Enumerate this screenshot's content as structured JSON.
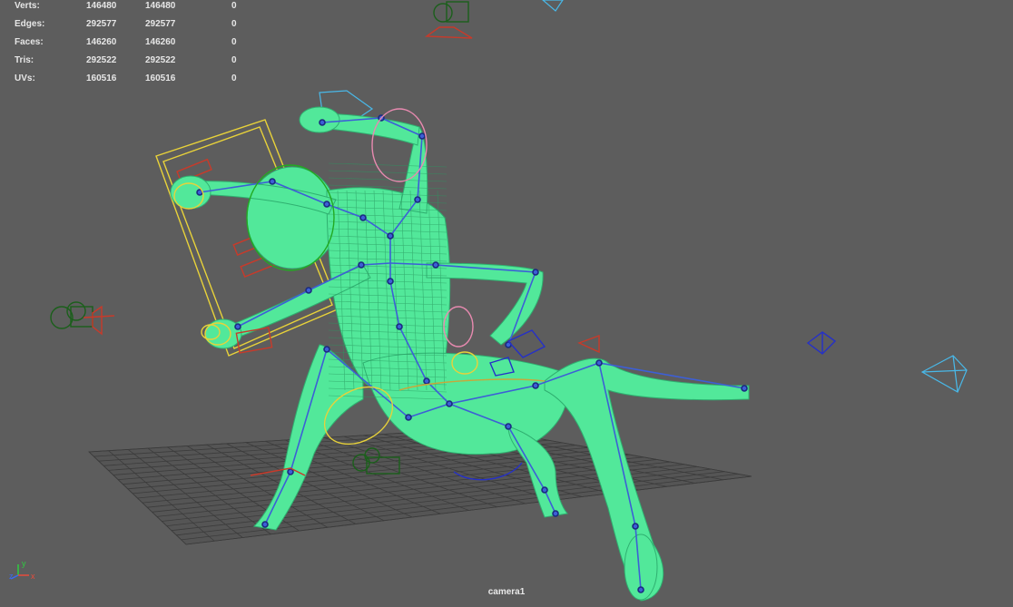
{
  "poly_count": {
    "rows": [
      {
        "label": "Verts:",
        "v1": "146480",
        "v2": "146480",
        "v3": "0"
      },
      {
        "label": "Edges:",
        "v1": "292577",
        "v2": "292577",
        "v3": "0"
      },
      {
        "label": "Faces:",
        "v1": "146260",
        "v2": "146260",
        "v3": "0"
      },
      {
        "label": "Tris:",
        "v1": "292522",
        "v2": "292522",
        "v3": "0"
      },
      {
        "label": "UVs:",
        "v1": "160516",
        "v2": "160516",
        "v3": "0"
      }
    ]
  },
  "viewport": {
    "camera_name": "camera1",
    "background_color": "#5d5d5d",
    "mesh_color": "#52e89a",
    "skeleton_color": "#3d5fd6",
    "control_color": "#e8d23a",
    "camera_icon_color": "#49b8e8"
  },
  "axis_gizmo": {
    "x_label": "x",
    "y_label": "y",
    "z_label": "z"
  }
}
